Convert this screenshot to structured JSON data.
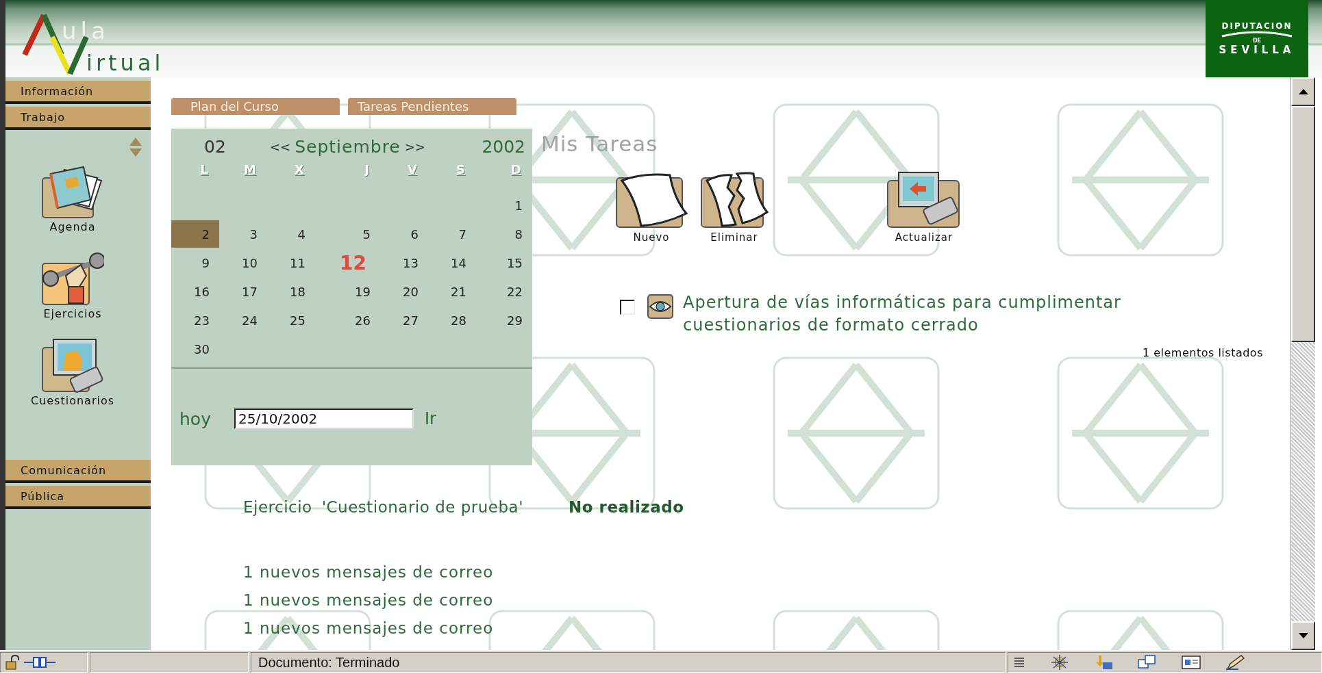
{
  "header": {
    "logo_top": "ula",
    "logo_bottom": "irtual",
    "emblem": {
      "arc": "DIPUTACION",
      "middle": "DE",
      "bottom": "SEVILLA"
    }
  },
  "sidebar": {
    "sections": [
      {
        "label": "Información"
      },
      {
        "label": "Trabajo",
        "items": [
          {
            "label": "Agenda",
            "kind": "agenda"
          },
          {
            "label": "Ejercicios",
            "kind": "exercises"
          },
          {
            "label": "Cuestionarios",
            "kind": "quiz"
          }
        ]
      },
      {
        "label": "Comunicación"
      },
      {
        "label": "Pública"
      }
    ]
  },
  "tabs": [
    {
      "label": "Plan del Curso",
      "selected": false
    },
    {
      "label": "Tareas Pendientes",
      "selected": false
    }
  ],
  "calendar": {
    "day": "02",
    "prev": "<<",
    "month": "Septiembre",
    "next": ">>",
    "year": "2002",
    "weekdays": [
      "L",
      "M",
      "X",
      "J",
      "V",
      "S",
      "D"
    ],
    "weeks": [
      {
        "days": [
          {
            "kind": "empty"
          },
          {
            "kind": "empty"
          },
          {
            "kind": "empty"
          },
          {
            "kind": "empty"
          },
          {
            "kind": "empty"
          },
          {
            "kind": "empty"
          },
          {
            "kind": "day",
            "d": "1",
            "selected": false,
            "today": false
          }
        ]
      },
      {
        "days": [
          {
            "d": "2",
            "selected": true,
            "today": false
          },
          {
            "d": "3",
            "selected": false,
            "today": false
          },
          {
            "d": "4",
            "selected": false,
            "today": false
          },
          {
            "d": "5",
            "selected": false,
            "today": false
          },
          {
            "d": "6",
            "selected": false,
            "today": false
          },
          {
            "d": "7",
            "selected": false,
            "today": false
          },
          {
            "d": "8",
            "selected": false,
            "today": false
          }
        ]
      },
      {
        "days": [
          {
            "d": "9",
            "selected": false,
            "today": false
          },
          {
            "d": "10",
            "selected": false,
            "today": false
          },
          {
            "d": "11",
            "selected": false,
            "today": false
          },
          {
            "d": "12",
            "selected": false,
            "today": true
          },
          {
            "d": "13",
            "selected": false,
            "today": false
          },
          {
            "d": "14",
            "selected": false,
            "today": false
          },
          {
            "d": "15",
            "selected": false,
            "today": false
          }
        ]
      },
      {
        "days": [
          {
            "d": "16",
            "selected": false,
            "today": false
          },
          {
            "d": "17",
            "selected": false,
            "today": false
          },
          {
            "d": "18",
            "selected": false,
            "today": false
          },
          {
            "d": "19",
            "selected": false,
            "today": false
          },
          {
            "d": "20",
            "selected": false,
            "today": false
          },
          {
            "d": "21",
            "selected": false,
            "today": false
          },
          {
            "d": "22",
            "selected": false,
            "today": false
          }
        ]
      },
      {
        "days": [
          {
            "d": "23",
            "selected": false,
            "today": false
          },
          {
            "d": "24",
            "selected": false,
            "today": false
          },
          {
            "d": "25",
            "selected": false,
            "today": false
          },
          {
            "d": "26",
            "selected": false,
            "today": false
          },
          {
            "d": "27",
            "selected": false,
            "today": false
          },
          {
            "d": "28",
            "selected": false,
            "today": false
          },
          {
            "d": "29",
            "selected": false,
            "today": false
          }
        ]
      },
      {
        "days": [
          {
            "kind": "day",
            "d": "30",
            "selected": false,
            "today": false
          }
        ]
      }
    ],
    "date_label": "hoy",
    "date_value": "25/10/2002",
    "go": "Ir"
  },
  "tasks_panel": {
    "title": "Mis Tareas",
    "toolbar": [
      {
        "label": "Nuevo",
        "kind": "new"
      },
      {
        "label": "Eliminar",
        "kind": "delete"
      },
      {
        "label": "Actualizar",
        "kind": "refresh"
      }
    ],
    "tasks": [
      {
        "checked": false,
        "title": "Apertura de vías informáticas para cumplimentar cuestionarios de formato cerrado"
      }
    ],
    "count": "1 elementos listados"
  },
  "exercise": {
    "label": "Ejercicio",
    "name": "'Cuestionario de prueba'",
    "status": "No realizado"
  },
  "messages": [
    "1 nuevos mensajes de correo",
    "1 nuevos mensajes de correo",
    "1 nuevos mensajes de correo"
  ],
  "status_bar": {
    "text": "Documento: Terminado"
  }
}
